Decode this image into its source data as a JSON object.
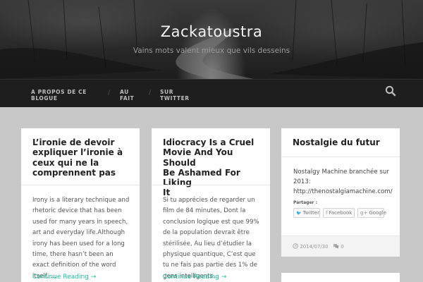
{
  "site": {
    "title": "Zackatoustra",
    "description": "Vains mots valent mieux que vils desseins"
  },
  "nav": {
    "items": [
      {
        "line1": "A propos de ce",
        "line2": "blogue"
      },
      {
        "line1": "Au",
        "line2": "fait"
      },
      {
        "line1": "Sur",
        "line2": "Twitter"
      }
    ],
    "separator": "/",
    "search_icon": "search-icon"
  },
  "posts": [
    {
      "title_lines": [
        "L’ironie de devoir",
        "expliquer l’ironie à",
        "ceux qui ne la",
        "comprennent pas"
      ],
      "excerpt_lines": [
        "Irony is a literary technique and",
        "rhetoric device that has been",
        "used for many years in speech,",
        "art and everyday life.Although",
        "irony has been used for a long",
        "time, there hasn’t been an",
        "exact definition of the word",
        "itself.  …"
      ],
      "continue": "Continue Reading →"
    },
    {
      "title_lines": [
        "Idiocracy Is a Cruel",
        "Movie And You Should",
        "Be Ashamed For Liking",
        "It"
      ],
      "excerpt_lines": [
        "Si tu apprécies de regarder un",
        "film de 84 minutes, Dont la",
        "conclusion logique est que 99%",
        "de la population devrait être",
        "stérilisée, Au lieu d’étudier la",
        "physique quantique, C’est que",
        "tu ne fais pas partie des 1% de",
        "gens intelligents…"
      ],
      "continue": "Continue Reading →"
    }
  ],
  "aside_post": {
    "title": "Nostalgie du futur",
    "body_lines": [
      "Nostalgy Machine branchée sur",
      "2013:",
      "http://thenostalgiamachine.com/"
    ],
    "share_label": "Partager :",
    "share_buttons": [
      {
        "icon": "twitter-icon",
        "glyph": "🐦",
        "label": "Twitter"
      },
      {
        "icon": "facebook-icon",
        "glyph": "f",
        "label": "Facebook"
      },
      {
        "icon": "google-plus-icon",
        "glyph": "g+",
        "label": "Google"
      }
    ],
    "date": "2014/07/30",
    "comments": "0"
  }
}
